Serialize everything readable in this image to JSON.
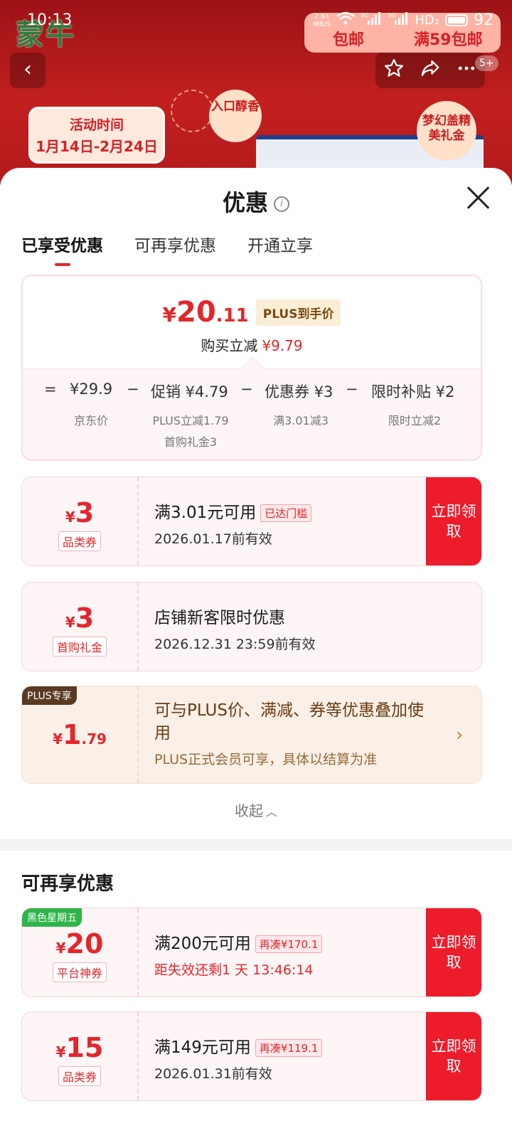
{
  "status_bar": {
    "time": "10:13",
    "speed": "2.61",
    "speed_unit": "MB/S",
    "net1": "5G",
    "net2": "5G",
    "hd": "HD₂",
    "battery": "92"
  },
  "banner": {
    "brand": "蒙牛",
    "promo_a": "包邮",
    "promo_b": "满59包邮",
    "date_label": "活动时间",
    "date_range": "1月14日-2月24日",
    "circle1": "入口醇香",
    "circle2": "梦幻盖精美礼金",
    "nav_badge": "5+"
  },
  "sheet": {
    "title": "优惠",
    "tabs": [
      "已享受优惠",
      "可再享优惠",
      "开通立享"
    ]
  },
  "summary": {
    "price_yen": "¥",
    "price_int": "20",
    "price_dec": ".11",
    "plus_tag": "PLUS到手价",
    "reduce_label": "购买立减",
    "reduce_amount": "¥9.79",
    "formula": {
      "eq": "=",
      "jd_price": "¥29.9",
      "minus1": "−",
      "promo": "促销 ¥4.79",
      "minus2": "−",
      "coupon": "优惠券 ¥3",
      "minus3": "−",
      "subsidy": "限时补贴 ¥2"
    },
    "sub": {
      "jd_price": "京东价",
      "promo_1": "PLUS立减1.79",
      "promo_2": "首购礼金3",
      "coupon": "满3.01减3",
      "subsidy": "限时立减2"
    }
  },
  "coupons": [
    {
      "yen": "¥",
      "amount": "3",
      "type": "品类券",
      "line1": "满3.01元可用",
      "tag": "已达门槛",
      "line2": "2026.01.17前有效",
      "claim": "立即领取"
    },
    {
      "yen": "¥",
      "amount": "3",
      "type": "首购礼金",
      "line1": "店铺新客限时优惠",
      "line2": "2026.12.31 23:59前有效"
    },
    {
      "corner": "PLUS专享",
      "yen": "¥",
      "amount": "1",
      "dec": ".79",
      "line1": "可与PLUS价、满减、券等优惠叠加使用",
      "line2": "PLUS正式会员可享，具体以结算为准"
    }
  ],
  "collapse_label": "收起",
  "section2": {
    "title": "可再享优惠",
    "coupons": [
      {
        "corner": "黑色星期五",
        "yen": "¥",
        "amount": "20",
        "type": "平台神券",
        "line1": "满200元可用",
        "tag": "再凑¥170.1",
        "line2": "距失效还剩1 天 13:46:14",
        "claim": "立即领取"
      },
      {
        "yen": "¥",
        "amount": "15",
        "type": "品类券",
        "line1": "满149元可用",
        "tag": "再凑¥119.1",
        "line2": "2026.01.31前有效",
        "claim": "立即领取"
      }
    ]
  },
  "colors": {
    "accent_red": "#e4262b",
    "claim_red": "#ed1c2b",
    "plus_brown": "#5a3a22",
    "friday_green": "#2fb54a"
  }
}
